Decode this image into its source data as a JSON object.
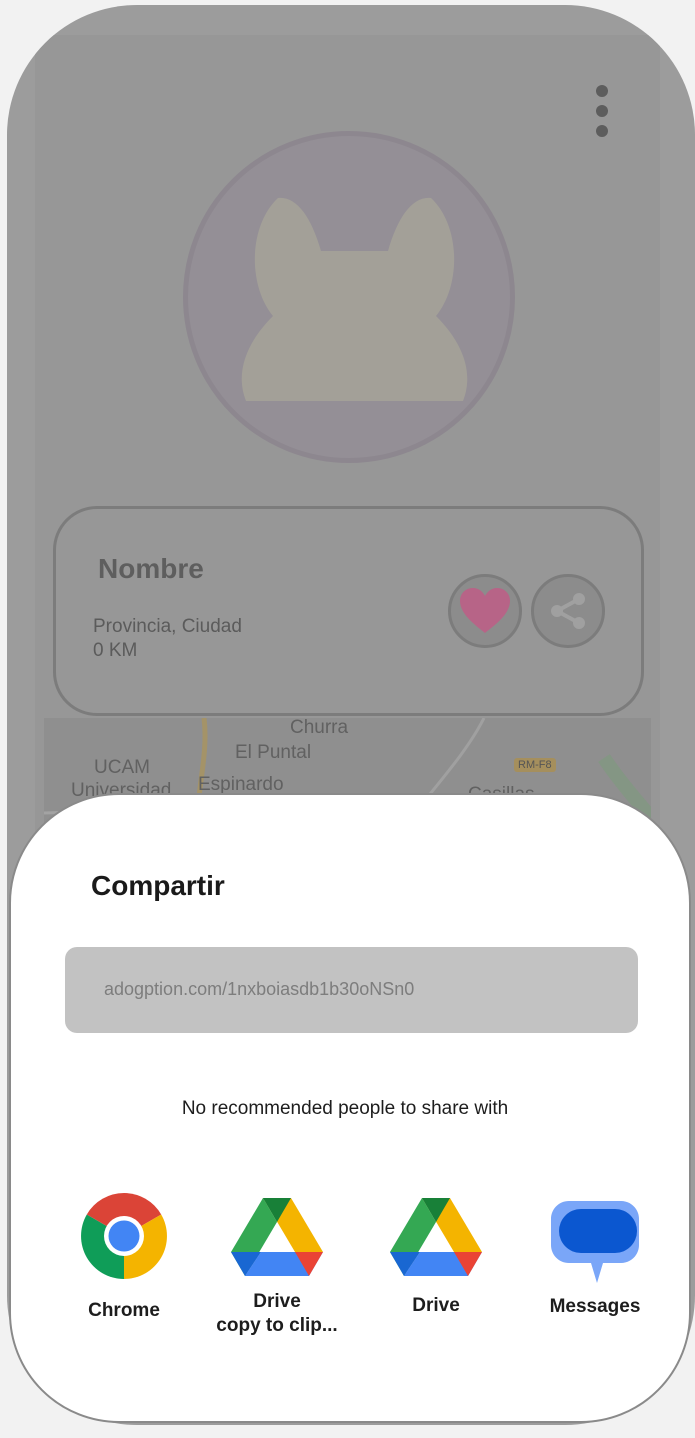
{
  "background_screen": {
    "pet_name": "Nombre",
    "location": "Provincia, Ciudad",
    "distance": "0 KM",
    "map_labels": [
      "Churra",
      "El Puntal",
      "UCAM",
      "Universidad",
      "Espinardo",
      "Casillas"
    ],
    "map_road_sign": "RM-F8"
  },
  "share_sheet": {
    "title": "Compartir",
    "url": "adogption.com/1nxboiasdb1b30oNSn0",
    "no_recommendations": "No recommended people to share with",
    "apps": [
      {
        "label": "Chrome",
        "icon": "chrome-icon"
      },
      {
        "label_line1": "Drive",
        "label_line2": "copy to clip...",
        "icon": "drive-icon"
      },
      {
        "label": "Drive",
        "icon": "drive-icon"
      },
      {
        "label": "Messages",
        "icon": "messages-icon"
      }
    ]
  },
  "colors": {
    "heart": "#b76487",
    "chrome_red": "#db4437",
    "chrome_green": "#0f9d58",
    "chrome_yellow": "#f4b400",
    "chrome_blue": "#4285f4",
    "messages_blue": "#0b57d0"
  }
}
